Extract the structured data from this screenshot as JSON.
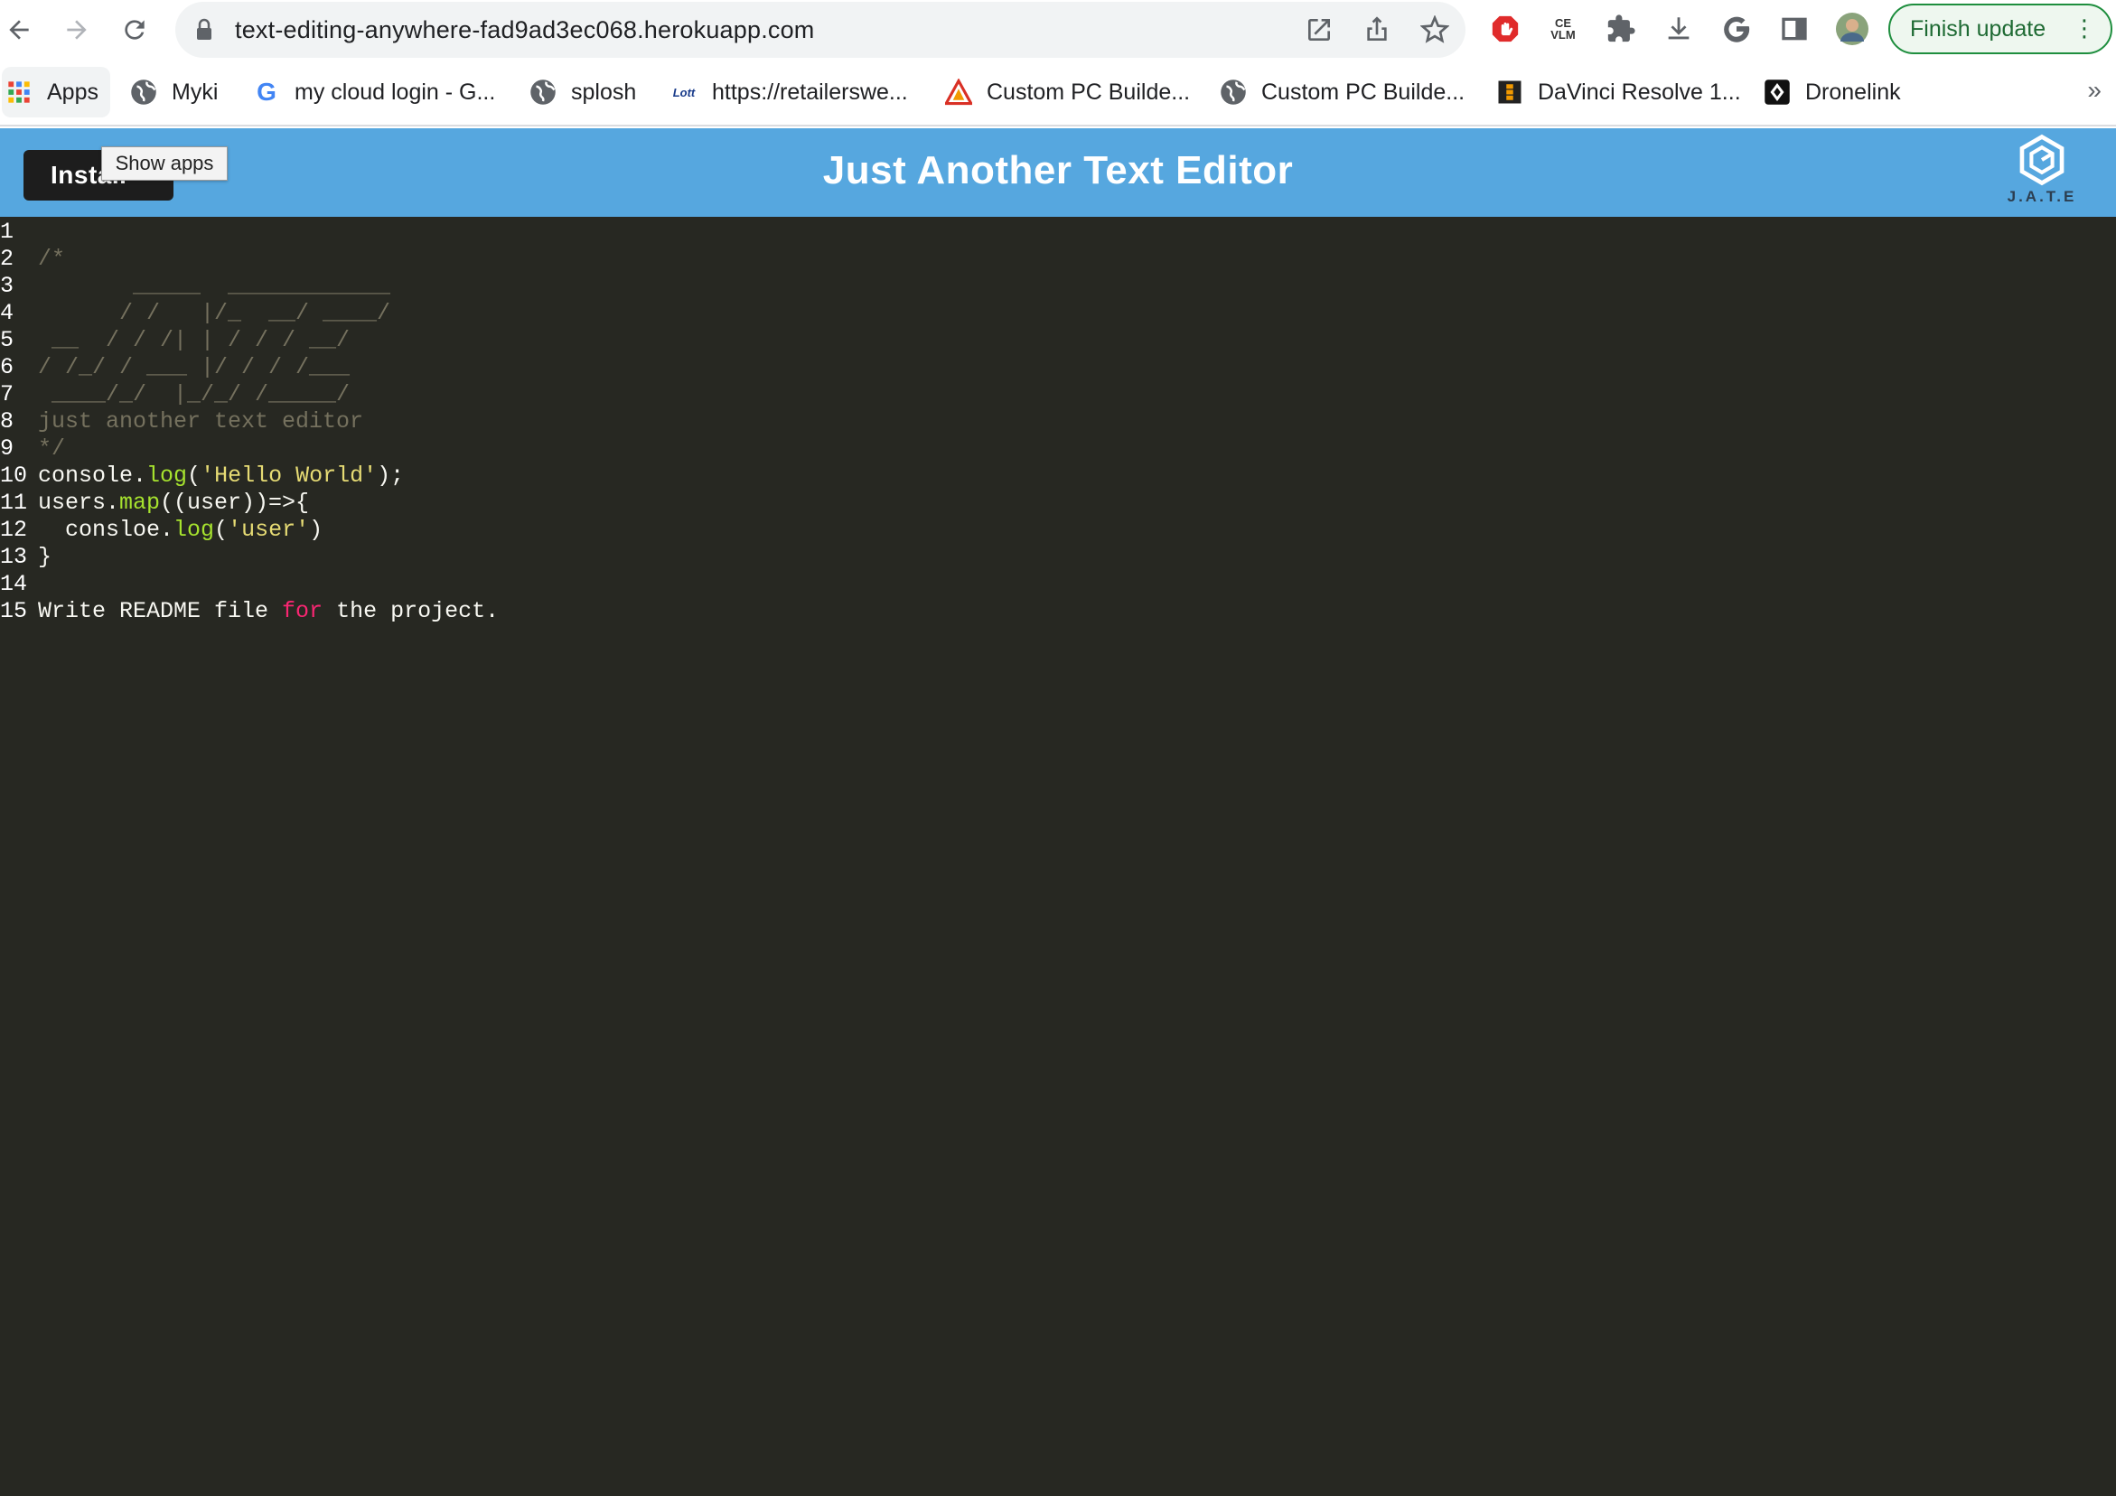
{
  "browser": {
    "url": "text-editing-anywhere-fad9ad3ec068.herokuapp.com",
    "finish_update_label": "Finish update",
    "extension_ce_label": "CE\nVLM",
    "bookmarks": [
      {
        "label": "Apps",
        "icon": "apps-grid-icon"
      },
      {
        "label": "Myki",
        "icon": "globe-icon"
      },
      {
        "label": "my cloud login - G...",
        "icon": "google-icon"
      },
      {
        "label": "splosh",
        "icon": "globe-icon"
      },
      {
        "label": "https://retailerswe...",
        "icon": "lott-icon"
      },
      {
        "label": "Custom PC Builde...",
        "icon": "triangle-logo-icon"
      },
      {
        "label": "Custom PC Builde...",
        "icon": "globe-icon"
      },
      {
        "label": "DaVinci Resolve 1...",
        "icon": "davinci-icon"
      },
      {
        "label": "Dronelink",
        "icon": "dronelink-icon"
      }
    ],
    "more_bookmarks": "»"
  },
  "app": {
    "title": "Just Another Text Editor",
    "install_label": "Install",
    "tooltip": "Show apps",
    "logo_text": "J.A.T.E",
    "colors": {
      "header": "#56a7df",
      "editor_bg": "#272822",
      "comment": "#75715e",
      "function": "#a6e22e",
      "string": "#e6db74",
      "keyword": "#f92672"
    }
  },
  "editor": {
    "lines": [
      {
        "n": "1",
        "segments": []
      },
      {
        "n": "2",
        "segments": [
          {
            "t": "/*",
            "k": "comment"
          }
        ]
      },
      {
        "n": "3",
        "segments": [
          {
            "t": "       _____  ____________",
            "k": "comment"
          }
        ]
      },
      {
        "n": "4",
        "segments": [
          {
            "t": "      / /   |/_  __/ ____/",
            "k": "comment"
          }
        ]
      },
      {
        "n": "5",
        "segments": [
          {
            "t": " __  / / /| | / / / __/",
            "k": "comment"
          }
        ]
      },
      {
        "n": "6",
        "segments": [
          {
            "t": "/ /_/ / ___ |/ / / /___",
            "k": "comment"
          }
        ]
      },
      {
        "n": "7",
        "segments": [
          {
            "t": " ____/_/  |_/_/ /_____/",
            "k": "comment"
          }
        ]
      },
      {
        "n": "8",
        "segments": [
          {
            "t": "just another text editor",
            "k": "comment"
          }
        ]
      },
      {
        "n": "9",
        "segments": [
          {
            "t": "*/",
            "k": "comment"
          }
        ]
      },
      {
        "n": "10",
        "segments": [
          {
            "t": "console.",
            "k": "plain"
          },
          {
            "t": "log",
            "k": "fn"
          },
          {
            "t": "(",
            "k": "plain"
          },
          {
            "t": "'Hello World'",
            "k": "str"
          },
          {
            "t": ");",
            "k": "plain"
          }
        ]
      },
      {
        "n": "11",
        "segments": [
          {
            "t": "users.",
            "k": "plain"
          },
          {
            "t": "map",
            "k": "fn"
          },
          {
            "t": "((user))=>{",
            "k": "plain"
          }
        ]
      },
      {
        "n": "12",
        "segments": [
          {
            "t": "  consloe.",
            "k": "plain"
          },
          {
            "t": "log",
            "k": "fn"
          },
          {
            "t": "(",
            "k": "plain"
          },
          {
            "t": "'user'",
            "k": "str"
          },
          {
            "t": ")",
            "k": "plain"
          }
        ]
      },
      {
        "n": "13",
        "segments": [
          {
            "t": "}",
            "k": "plain"
          }
        ]
      },
      {
        "n": "14",
        "segments": []
      },
      {
        "n": "15",
        "segments": [
          {
            "t": "Write README file ",
            "k": "plain"
          },
          {
            "t": "for",
            "k": "kw"
          },
          {
            "t": " the project.",
            "k": "plain"
          }
        ]
      }
    ]
  }
}
